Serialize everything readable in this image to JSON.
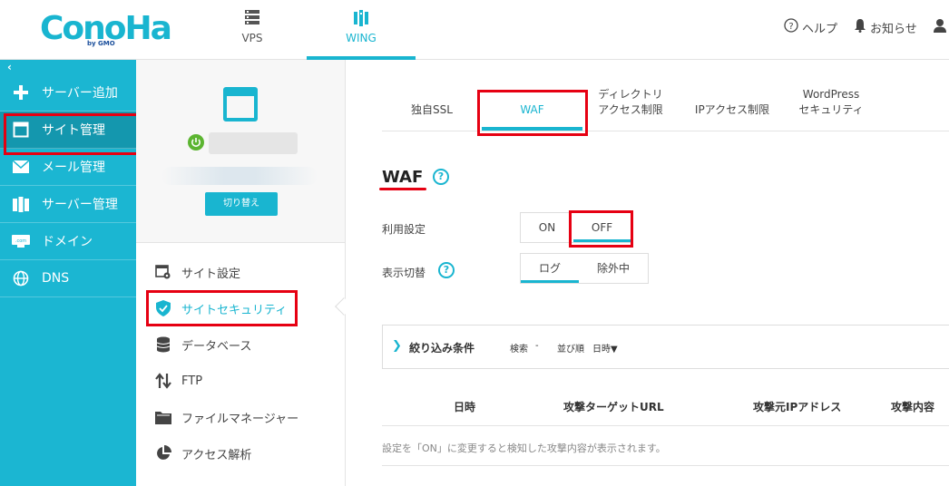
{
  "header": {
    "logo": "ConoHa",
    "logo_sub": "by GMO",
    "nav": [
      {
        "label": "VPS",
        "icon": "server-icon"
      },
      {
        "label": "WING",
        "icon": "wing-server-icon"
      }
    ],
    "help_label": "ヘルプ",
    "notice_label": "お知らせ"
  },
  "sidebar": {
    "collapse_label": "‹",
    "items": [
      {
        "label": "サーバー追加",
        "icon": "plus-icon"
      },
      {
        "label": "サイト管理",
        "icon": "window-icon",
        "active": true
      },
      {
        "label": "メール管理",
        "icon": "mail-icon"
      },
      {
        "label": "サーバー管理",
        "icon": "server-manage-icon"
      },
      {
        "label": "ドメイン",
        "icon": "domain-icon"
      },
      {
        "label": "DNS",
        "icon": "globe-icon"
      }
    ]
  },
  "site_panel": {
    "switch_label": "切り替え",
    "menu": [
      {
        "label": "サイト設定",
        "icon": "site-settings-icon"
      },
      {
        "label": "サイトセキュリティ",
        "icon": "shield-icon",
        "active": true
      },
      {
        "label": "データベース",
        "icon": "database-icon"
      },
      {
        "label": "FTP",
        "icon": "ftp-icon"
      },
      {
        "label": "ファイルマネージャー",
        "icon": "folder-icon"
      },
      {
        "label": "アクセス解析",
        "icon": "pie-chart-icon"
      }
    ]
  },
  "main": {
    "tabs": [
      {
        "label": "独自SSL"
      },
      {
        "label": "WAF",
        "active": true
      },
      {
        "label": "ディレクトリ\nアクセス制限"
      },
      {
        "label": "IPアクセス制限"
      },
      {
        "label": "WordPress\nセキュリティ"
      }
    ],
    "title": "WAF",
    "help_glyph": "?",
    "usage_label": "利用設定",
    "usage_options": [
      "ON",
      "OFF"
    ],
    "usage_selected": "OFF",
    "display_label": "表示切替",
    "display_options": [
      "ログ",
      "除外中"
    ],
    "display_selected": "ログ",
    "filter": {
      "title": "絞り込み条件",
      "search_label": "検索",
      "search_value": "-",
      "sort_label": "並び順",
      "sort_value": "日時▼"
    },
    "table_headers": [
      "日時",
      "攻撃ターゲットURL",
      "攻撃元IPアドレス",
      "攻撃内容"
    ],
    "empty_message": "設定を「ON」に変更すると検知した攻撃内容が表示されます。"
  },
  "colors": {
    "accent": "#19b5d0",
    "sidebar_bg": "#1bb6d2",
    "highlight_red": "#e60012"
  }
}
